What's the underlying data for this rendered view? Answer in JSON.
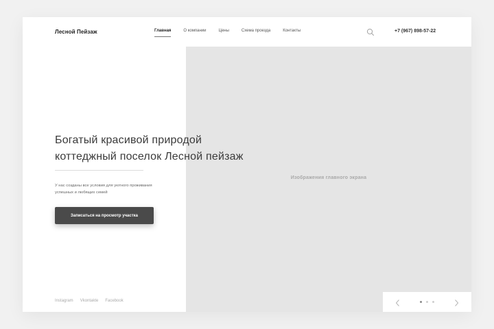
{
  "header": {
    "logo": "Лесной Пейзаж",
    "nav": [
      {
        "label": "Главная",
        "active": true
      },
      {
        "label": "О компании",
        "active": false
      },
      {
        "label": "Цены",
        "active": false
      },
      {
        "label": "Схема проезда",
        "active": false
      },
      {
        "label": "Контакты",
        "active": false
      }
    ],
    "search_icon": "search-icon",
    "phone": "+7 (967) 898-57-22"
  },
  "hero": {
    "title_line1": "Богатый красивой природой",
    "title_line2": "коттеджный поселок Лесной пейзаж",
    "subtitle_line1": "У нас созданы все условия для уютного проживания",
    "subtitle_line2": "успешных и любящих семей",
    "cta_label": "Записаться на просмотр участка",
    "image_label": "Изображения главного экрана"
  },
  "socials": [
    "Instagram",
    "Vkontakte",
    "Facebook"
  ],
  "slider": {
    "dots": 3,
    "active_index": 0
  },
  "colors": {
    "background": "#f1f1f1",
    "panel": "#ffffff",
    "image_placeholder": "#e5e5e5",
    "button": "#4a4a4a"
  }
}
